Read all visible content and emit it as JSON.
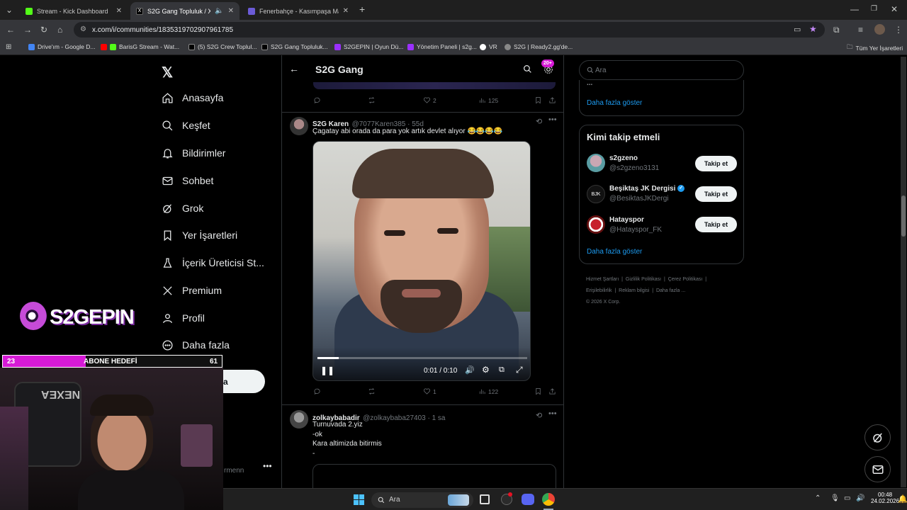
{
  "browser": {
    "tabs": [
      {
        "title": "Stream - Kick Dashboard",
        "color": "#53fc18"
      },
      {
        "title": "S2G Gang Topluluk / X",
        "color": "#000000"
      },
      {
        "title": "Fenerbahçe - Kasımpaşa Maç C",
        "color": "#6b5bd6"
      }
    ],
    "url": "x.com/i/communities/1835319702907961785",
    "bookmarks": [
      "Drive'ım - Google D...",
      "BarisG Stream - Wat...",
      "(5) S2G Crew Toplul...",
      "S2G Gang Topluluk...",
      "S2GEPIN | Oyun Dü...",
      "Yönetim Paneli | s2g...",
      "VR",
      "S2G | Ready2.gg'de..."
    ],
    "all_bookmarks": "Tüm Yer İşaretleri"
  },
  "nav": {
    "items": [
      "Anasayfa",
      "Keşfet",
      "Bildirimler",
      "Sohbet",
      "Grok",
      "Yer İşaretleri",
      "İçerik Üreticisi St...",
      "Premium",
      "Profil",
      "Daha fazla"
    ],
    "post_button": "Yayınla",
    "account_fragment": "rmenn"
  },
  "overlay": {
    "logo": "S2GEPIN",
    "sub_goal_label": "ABONE HEDEFİ",
    "sub_current": "23",
    "sub_target": "61",
    "sub_progress": 0.38
  },
  "header": {
    "title": "S2G Gang",
    "notif_badge": "20+"
  },
  "prev_post": {
    "likes": "2",
    "views": "125"
  },
  "post1": {
    "name": "S2G Karen",
    "handle": "@7077Karen385 · 55d",
    "text": "Çagatay abi orada da para yok artık devlet alıyor 😂😂😂😂",
    "video_time": "0:01 / 0:10",
    "video_progress": 0.1,
    "likes": "1",
    "views": "122"
  },
  "post2": {
    "name": "zolkaybabadir",
    "handle": "@zolkaybaba27403 · 1 sa",
    "lines": [
      "Turnuvada 2.yiz",
      "-ok",
      "Kara altimizda bitirmis",
      "-"
    ]
  },
  "right": {
    "search_placeholder": "Ara",
    "top_card_fragment": "...",
    "show_more": "Daha fazla göster",
    "who_to_follow_title": "Kimi takip etmeli",
    "follow_label": "Takip et",
    "suggestions": [
      {
        "name": "s2gzeno",
        "handle": "@s2gzeno3131",
        "verified": false
      },
      {
        "name": "Beşiktaş JK Dergisi",
        "handle": "@BesiktasJKDergi",
        "verified": true
      },
      {
        "name": "Hatayspor",
        "handle": "@Hatayspor_FK",
        "verified": false
      }
    ],
    "footer_row1": [
      "Hizmet Şartları",
      "Gizlilik Politikası",
      "Çerez Politikası"
    ],
    "footer_row2": [
      "Erişilebilirlik",
      "Reklam bilgisi",
      "Daha fazla ..."
    ],
    "copyright": "© 2026 X Corp."
  },
  "taskbar": {
    "search_placeholder": "Ara",
    "time": "00:48",
    "date": "24.02.2026"
  },
  "colors": {
    "accent": "#1d9bf0",
    "overlay_pink": "#d61ad6",
    "kick_green": "#53fc18"
  }
}
